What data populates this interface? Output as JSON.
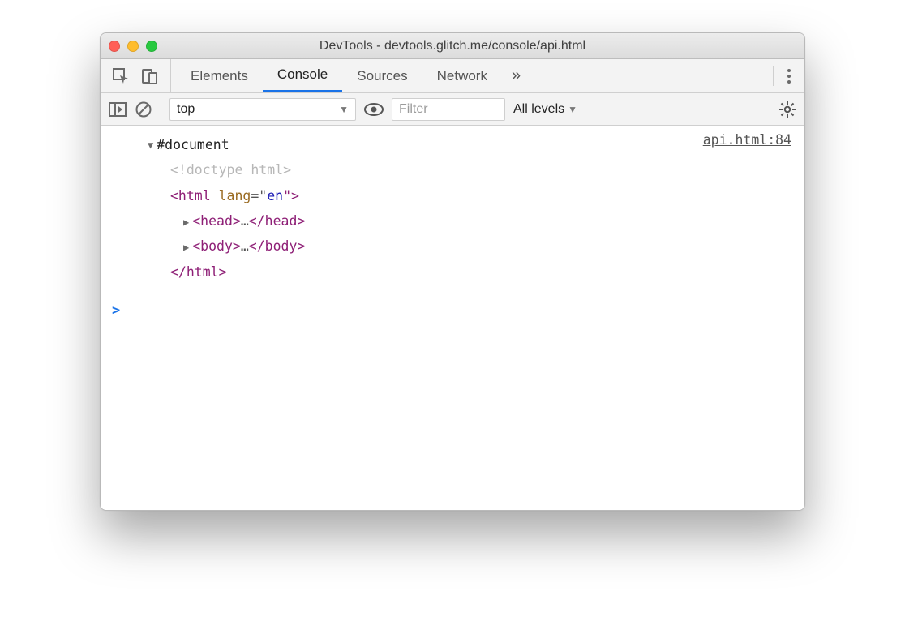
{
  "window": {
    "title": "DevTools - devtools.glitch.me/console/api.html"
  },
  "tabs": {
    "items": [
      "Elements",
      "Console",
      "Sources",
      "Network"
    ],
    "active_index": 1,
    "more_glyph": "»"
  },
  "subbar": {
    "context": "top",
    "filter_placeholder": "Filter",
    "levels_label": "All levels"
  },
  "console": {
    "source_link": "api.html:84",
    "root_label": "#document",
    "doctype": "<!doctype html>",
    "html_open_prefix": "<html ",
    "html_attr_name": "lang",
    "html_attr_eq": "=\"",
    "html_attr_val": "en",
    "html_attr_close": "\">",
    "head_open": "<head>",
    "head_ellipsis": "…",
    "head_close": "</head>",
    "body_open": "<body>",
    "body_ellipsis": "…",
    "body_close": "</body>",
    "html_close": "</html>",
    "prompt_glyph": ">"
  }
}
